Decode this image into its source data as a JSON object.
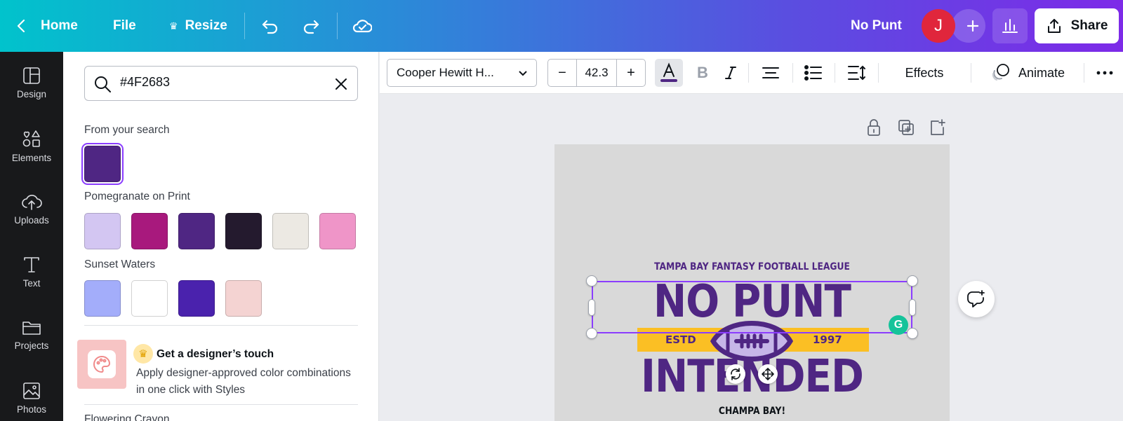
{
  "topbar": {
    "home_label": "Home",
    "file_label": "File",
    "resize_label": "Resize",
    "doc_title": "No Punt",
    "avatar_initial": "J",
    "share_label": "Share",
    "icons": [
      "chevron-left-icon",
      "crown-icon",
      "undo-icon",
      "redo-icon",
      "cloud-check-icon",
      "plus-icon",
      "insights-icon",
      "share-upload-icon"
    ]
  },
  "rail": {
    "items": [
      {
        "label": "Design",
        "icon": "design-icon"
      },
      {
        "label": "Elements",
        "icon": "elements-icon"
      },
      {
        "label": "Uploads",
        "icon": "upload-icon"
      },
      {
        "label": "Text",
        "icon": "text-icon"
      },
      {
        "label": "Projects",
        "icon": "folder-icon"
      },
      {
        "label": "Photos",
        "icon": "photo-icon"
      }
    ]
  },
  "panel": {
    "search_value": "#4F2683",
    "from_search_label": "From your search",
    "from_search_colors": [
      "#4f2683"
    ],
    "palette1": {
      "name": "Pomegranate on Print",
      "colors": [
        "#d3c6f2",
        "#a8197d",
        "#4f2683",
        "#241a2e",
        "#ece9e3",
        "#ef95c8"
      ]
    },
    "palette2": {
      "name": "Sunset Waters",
      "colors": [
        "#a3adfa",
        "#ffffff",
        "#4a22ad",
        "#f4d3d2"
      ]
    },
    "styles_title": "Get a designer’s touch",
    "styles_desc": "Apply designer-approved color combinations in one click with Styles",
    "next_palette_label": "Flowering Crayon"
  },
  "toolbar": {
    "font_name": "Cooper Hewitt H...",
    "font_size": "42.3",
    "minus": "−",
    "plus": "+",
    "effects_label": "Effects",
    "animate_label": "Animate",
    "text_color": "#4f2683"
  },
  "design": {
    "league": "TAMPA BAY FANTASY FOOTBALL LEAGUE",
    "line1": "NO PUNT",
    "estd": "ESTD",
    "year": "1997",
    "line2": "INTENDED",
    "tagline": "CHAMPA BAY!",
    "brand_color": "#4f2683",
    "banner_color": "#fbbf24",
    "canvas_bg": "#d9d9d9"
  }
}
